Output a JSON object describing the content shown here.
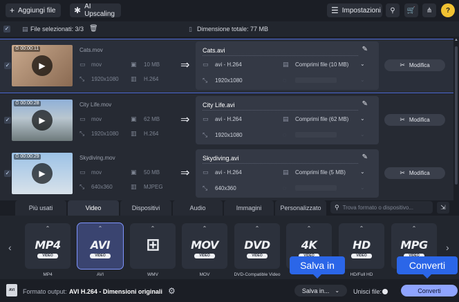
{
  "toolbar": {
    "add_files_label": "Aggiungi file",
    "ai_upscaling_label": "AI Upscaling",
    "settings_label": "Impostazioni"
  },
  "selection": {
    "selected_label": "File selezionati: 3/3",
    "total_size_label": "Dimensione totale: 77 MB"
  },
  "files": [
    {
      "duration": "00:00:11",
      "name": "Cats.mov",
      "container": "mov",
      "size": "10 MB",
      "resolution": "1920x1080",
      "codec": "H.264",
      "output_name": "Cats.avi",
      "output_codec": "avi - H.264",
      "compress": "Comprimi file (10 MB)",
      "output_resolution": "1920x1080",
      "edit_label": "Modifica",
      "selected": true,
      "thumb_colors": [
        "#c9a98d",
        "#8a6a52"
      ]
    },
    {
      "duration": "00:00:28",
      "name": "City Life.mov",
      "container": "mov",
      "size": "62 MB",
      "resolution": "1920x1080",
      "codec": "H.264",
      "output_name": "City Life.avi",
      "output_codec": "avi - H.264",
      "compress": "Comprimi file (62 MB)",
      "output_resolution": "1920x1080",
      "edit_label": "Modifica",
      "selected": false,
      "thumb_colors": [
        "#8fb0d8",
        "#6e7a7c"
      ]
    },
    {
      "duration": "00:00:29",
      "name": "Skydiving.mov",
      "container": "mov",
      "size": "50 MB",
      "resolution": "640x360",
      "codec": "MJPEG",
      "output_name": "Skydiving.avi",
      "output_codec": "avi - H.264",
      "compress": "Comprimi file (5 MB)",
      "output_resolution": "640x360",
      "edit_label": "Modifica",
      "selected": false,
      "thumb_colors": [
        "#9cc2e6",
        "#d8e2ea"
      ]
    }
  ],
  "tabs": [
    {
      "label": "Più usati"
    },
    {
      "label": "Video"
    },
    {
      "label": "Dispositivi"
    },
    {
      "label": "Audio"
    },
    {
      "label": "Immagini"
    },
    {
      "label": "Personalizzato"
    }
  ],
  "search": {
    "placeholder": "Trova formato o dispositivo..."
  },
  "formats": [
    {
      "logo": "MP4",
      "sub": "VIDEO",
      "label": "MP4"
    },
    {
      "logo": "AVI",
      "sub": "VIDEO",
      "label": "AVI"
    },
    {
      "logo": "⊞",
      "sub": "",
      "label": "WMV"
    },
    {
      "logo": "MOV",
      "sub": "VIDEO",
      "label": "MOV"
    },
    {
      "logo": "DVD",
      "sub": "VIDEO",
      "label": "DVD-Compatible Video"
    },
    {
      "logo": "4K",
      "sub": "VIDEO",
      "label": "4K"
    },
    {
      "logo": "HD",
      "sub": "VIDEO",
      "label": "HD/Full HD"
    },
    {
      "logo": "MPG",
      "sub": "VIDEO",
      "label": ""
    }
  ],
  "bottom": {
    "output_format_label": "Formato output:",
    "output_format_value": "AVI H.264 - Dimensioni originali",
    "save_in_label": "Salva in...",
    "merge_label": "Unisci file:",
    "convert_label": "Converti"
  },
  "callouts": {
    "save_in": "Salva in",
    "convert": "Converti"
  },
  "colors": {
    "accent": "#2b66e8",
    "convert_button": "#8fa4ff",
    "help": "#f1c232"
  }
}
